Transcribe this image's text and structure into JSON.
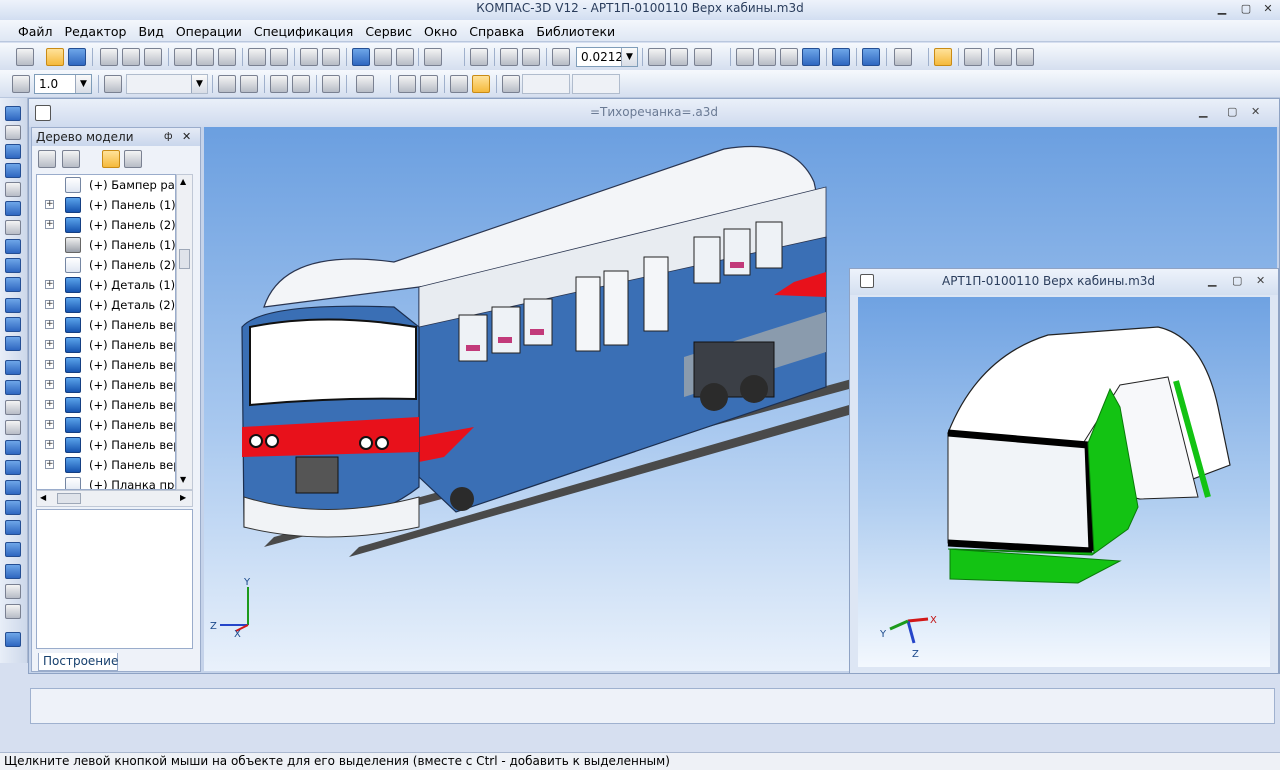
{
  "app": {
    "title": "КОМПАС-3D V12 - АРТ1П-0100110 Верх кабины.m3d"
  },
  "menu": {
    "items": [
      "Файл",
      "Редактор",
      "Вид",
      "Операции",
      "Спецификация",
      "Сервис",
      "Окно",
      "Справка",
      "Библиотеки"
    ]
  },
  "toolbar": {
    "zoom_value": "0.0212"
  },
  "toolbar2": {
    "line_step_value": "1.0",
    "style_value": "",
    "coord_x": "",
    "coord_y": ""
  },
  "doc1": {
    "title": "=Тихоречанка=.a3d"
  },
  "doc2": {
    "title": "АРТ1П-0100110 Верх кабины.m3d"
  },
  "tree": {
    "title": "Дерево модели",
    "pin": "ф",
    "close": "✕",
    "tab": "Построение",
    "items": [
      {
        "label": "(+) Бампер рам",
        "icon": "assembly-icon",
        "exp": ""
      },
      {
        "label": "(+) Панель (1)",
        "icon": "assembly-icon",
        "exp": "+"
      },
      {
        "label": "(+) Панель (2)",
        "icon": "assembly-icon",
        "exp": "+"
      },
      {
        "label": "(+) Панель (1)",
        "icon": "part-grey-icon",
        "exp": ""
      },
      {
        "label": "(+) Панель (2)",
        "icon": "part-white-icon",
        "exp": ""
      },
      {
        "label": "(+) Деталь (1)",
        "icon": "assembly-icon",
        "exp": "+"
      },
      {
        "label": "(+) Деталь (2)",
        "icon": "assembly-icon",
        "exp": "+"
      },
      {
        "label": "(+) Панель верх",
        "icon": "assembly-icon",
        "exp": "+"
      },
      {
        "label": "(+) Панель верх",
        "icon": "assembly-icon",
        "exp": "+"
      },
      {
        "label": "(+) Панель верх",
        "icon": "assembly-icon",
        "exp": "+"
      },
      {
        "label": "(+) Панель верх",
        "icon": "assembly-icon",
        "exp": "+"
      },
      {
        "label": "(+) Панель верх",
        "icon": "assembly-icon",
        "exp": "+"
      },
      {
        "label": "(+) Панель верх",
        "icon": "assembly-icon",
        "exp": "+"
      },
      {
        "label": "(+) Панель верх",
        "icon": "assembly-icon",
        "exp": "+"
      },
      {
        "label": "(+) Панель верх",
        "icon": "assembly-icon",
        "exp": "+"
      },
      {
        "label": "(+) Планка прос",
        "icon": "part-white-icon",
        "exp": ""
      }
    ]
  },
  "axes1": {
    "y": "Y",
    "z": "Z",
    "x": "X"
  },
  "axes2": {
    "y": "Y",
    "z": "Z",
    "x": "X"
  },
  "status": {
    "text": "Щелкните левой кнопкой мыши на объекте для его выделения (вместе с Ctrl - добавить к выделенным)"
  },
  "colors": {
    "accent_blue": "#2f67c0",
    "selection_green": "#13c313",
    "train_blue": "#3a6fb5",
    "train_red": "#e8111b"
  }
}
